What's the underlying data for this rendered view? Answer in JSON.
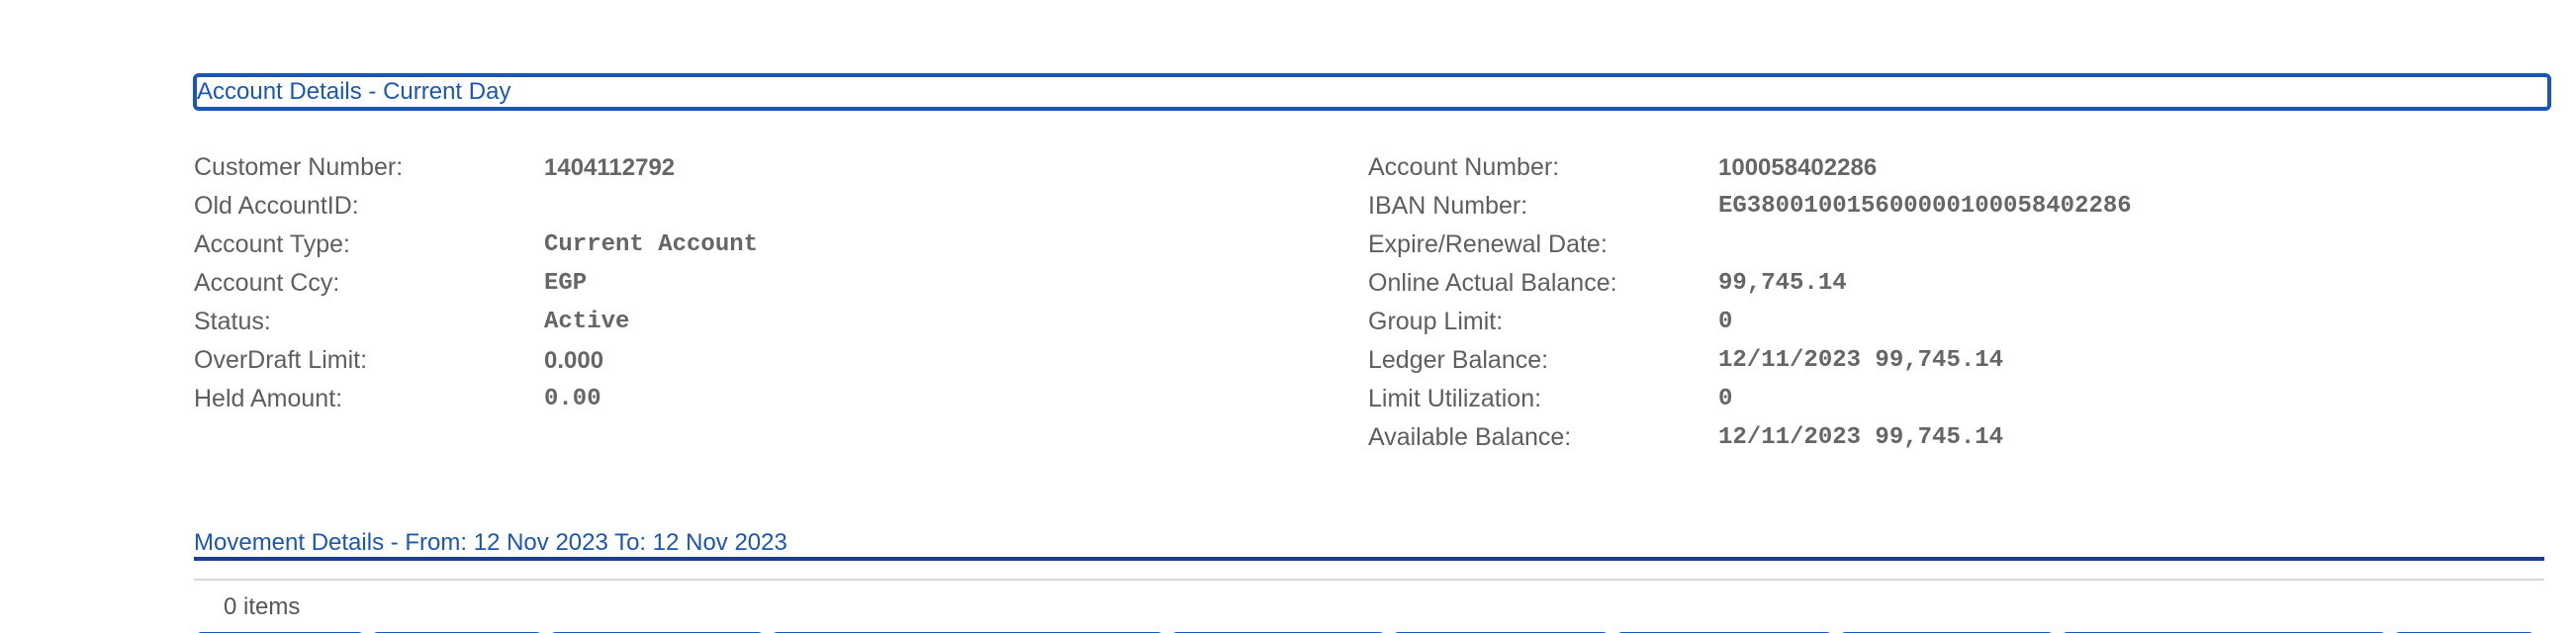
{
  "account_section": {
    "title": "Account Details - Current Day"
  },
  "left_details": [
    {
      "label": "Customer Number:",
      "value": "1404112792"
    },
    {
      "label": "Old AccountID:",
      "value": ""
    },
    {
      "label": "Account Type:",
      "value": "Current Account"
    },
    {
      "label": "Account Ccy:",
      "value": "EGP"
    },
    {
      "label": "Status:",
      "value": "Active"
    },
    {
      "label": "OverDraft Limit:",
      "value": "0.000"
    },
    {
      "label": "Held Amount:",
      "value": "0.00"
    }
  ],
  "right_details": [
    {
      "label": "Account Number:",
      "value": "100058402286"
    },
    {
      "label": "IBAN Number:",
      "value": "EG380010015600000100058402286"
    },
    {
      "label": "Expire/Renewal Date:",
      "value": ""
    },
    {
      "label": "Online Actual Balance:",
      "value": "99,745.14"
    },
    {
      "label": "Group Limit:",
      "value": "0"
    },
    {
      "label": "Ledger Balance:",
      "value": "12/11/2023 99,745.14"
    },
    {
      "label": "Limit Utilization:",
      "value": "0"
    },
    {
      "label": "Available Balance:",
      "value": "12/11/2023 99,745.14"
    }
  ],
  "movement_section": {
    "title": "Movement Details - From: 12 Nov 2023 To: 12 Nov 2023",
    "items_count": "0 items"
  },
  "colors": {
    "accent": "#1a57b4",
    "rule": "#1a3e96",
    "label_text": "#5e5e5e",
    "value_text": "#666666"
  }
}
